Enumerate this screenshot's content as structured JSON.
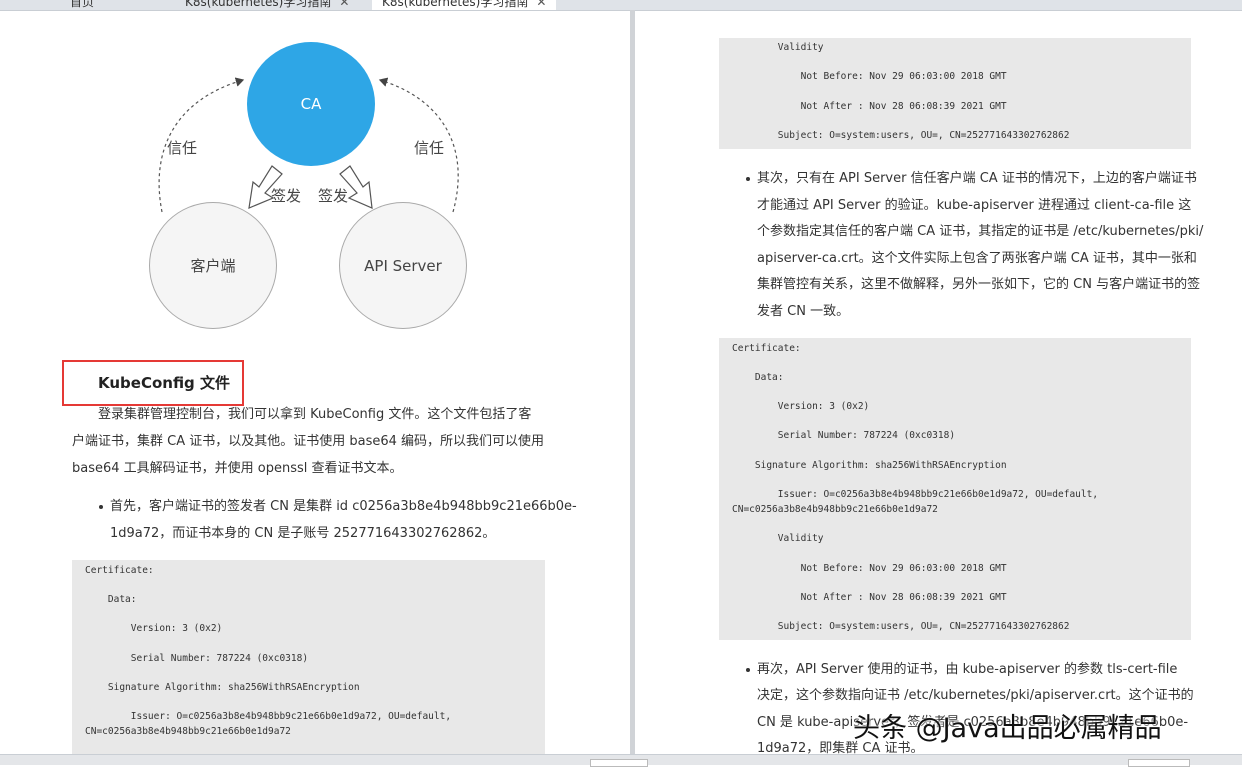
{
  "tabs": [
    {
      "label": "首页",
      "closable": false
    },
    {
      "label": "K8s(kubernetes)学习指南",
      "closable": true
    },
    {
      "label": "K8s(kubernetes)学习指南",
      "closable": true,
      "active": true
    }
  ],
  "diagram": {
    "ca": "CA",
    "client": "客户端",
    "apiserver": "API Server",
    "trust_left": "信任",
    "trust_right": "信任",
    "sign_left": "签发",
    "sign_right": "签发"
  },
  "left": {
    "heading": "KubeConfig 文件",
    "intro": [
      "登录集群管理控制台，我们可以拿到 KubeConfig 文件。这个文件包括了客",
      "户端证书，集群 CA 证书，以及其他。证书使用 base64 编码，所以我们可以使用",
      "base64 工具解码证书，并使用 openssl 查看证书文本。"
    ],
    "bullet1": [
      "首先，客户端证书的签发者 CN 是集群 id c0256a3b8e4b948bb9c21e66b0e-",
      "1d9a72，而证书本身的 CN 是子账号 252771643302762862。"
    ],
    "code": [
      "Certificate:",
      "    Data:",
      "        Version: 3 (0x2)",
      "        Serial Number: 787224 (0xc0318)",
      "    Signature Algorithm: sha256WithRSAEncryption",
      "        Issuer: O=c0256a3b8e4b948bb9c21e66b0e1d9a72, OU=default,",
      "CN=c0256a3b8e4b948bb9c21e66b0e1d9a72"
    ]
  },
  "right": {
    "code_top": [
      "        Validity",
      "            Not Before: Nov 29 06:03:00 2018 GMT",
      "            Not After : Nov 28 06:08:39 2021 GMT",
      "        Subject: O=system:users, OU=, CN=252771643302762862"
    ],
    "bullet2": [
      "其次，只有在 API Server 信任客户端 CA 证书的情况下，上边的客户端证书",
      "才能通过 API Server 的验证。kube-apiserver 进程通过 client-ca-file 这",
      "个参数指定其信任的客户端 CA 证书，其指定的证书是 /etc/kubernetes/pki/",
      "apiserver-ca.crt。这个文件实际上包含了两张客户端 CA 证书，其中一张和",
      "集群管控有关系，这里不做解释，另外一张如下，它的 CN 与客户端证书的签",
      "发者 CN 一致。"
    ],
    "code_mid": [
      "Certificate:",
      "    Data:",
      "        Version: 3 (0x2)",
      "        Serial Number: 787224 (0xc0318)",
      "    Signature Algorithm: sha256WithRSAEncryption",
      "        Issuer: O=c0256a3b8e4b948bb9c21e66b0e1d9a72, OU=default,",
      "CN=c0256a3b8e4b948bb9c21e66b0e1d9a72",
      "        Validity",
      "            Not Before: Nov 29 06:03:00 2018 GMT",
      "            Not After : Nov 28 06:08:39 2021 GMT",
      "        Subject: O=system:users, OU=, CN=252771643302762862"
    ],
    "bullet3": [
      "再次，API Server 使用的证书，由 kube-apiserver 的参数 tls-cert-file",
      "决定，这个参数指向证书 /etc/kubernetes/pki/apiserver.crt。这个证书的",
      "CN 是 kube-apiserver，签发者是 c0256a3b8e4b948bb9c21e66b0e-",
      "1d9a72，即集群 CA 证书。"
    ]
  },
  "watermark": "头条 @Java出品必属精品"
}
